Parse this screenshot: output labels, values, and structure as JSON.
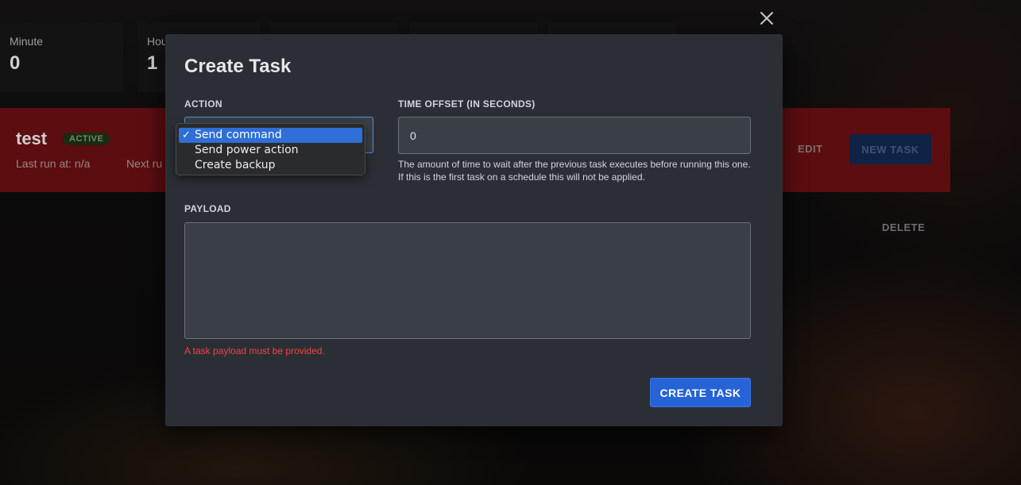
{
  "stats": [
    {
      "label": "Minute",
      "value": "0"
    },
    {
      "label": "Hou",
      "value": "1"
    }
  ],
  "schedule": {
    "title": "test",
    "status_badge": "ACTIVE",
    "last_run": "Last run at: n/a",
    "next_run": "Next ru",
    "edit_label": "EDIT",
    "new_task_label": "NEW TASK",
    "delete_label": "DELETE",
    "banner_color": "#5c0d10"
  },
  "modal": {
    "title": "Create Task",
    "action_label": "ACTION",
    "action_options": [
      "Send command",
      "Send power action",
      "Create backup"
    ],
    "action_selected": "Send command",
    "time_offset_label": "TIME OFFSET (IN SECONDS)",
    "time_offset_value": "0",
    "time_offset_help": "The amount of time to wait after the previous task executes before running this one. If this is the first task on a schedule this will not be applied.",
    "payload_label": "PAYLOAD",
    "payload_value": "",
    "payload_error": "A task payload must be provided.",
    "submit_label": "CREATE TASK",
    "accent_color": "#2563d6",
    "error_color": "#ef4444"
  },
  "icons": {
    "close": "close-icon",
    "check": "checkmark-icon"
  }
}
